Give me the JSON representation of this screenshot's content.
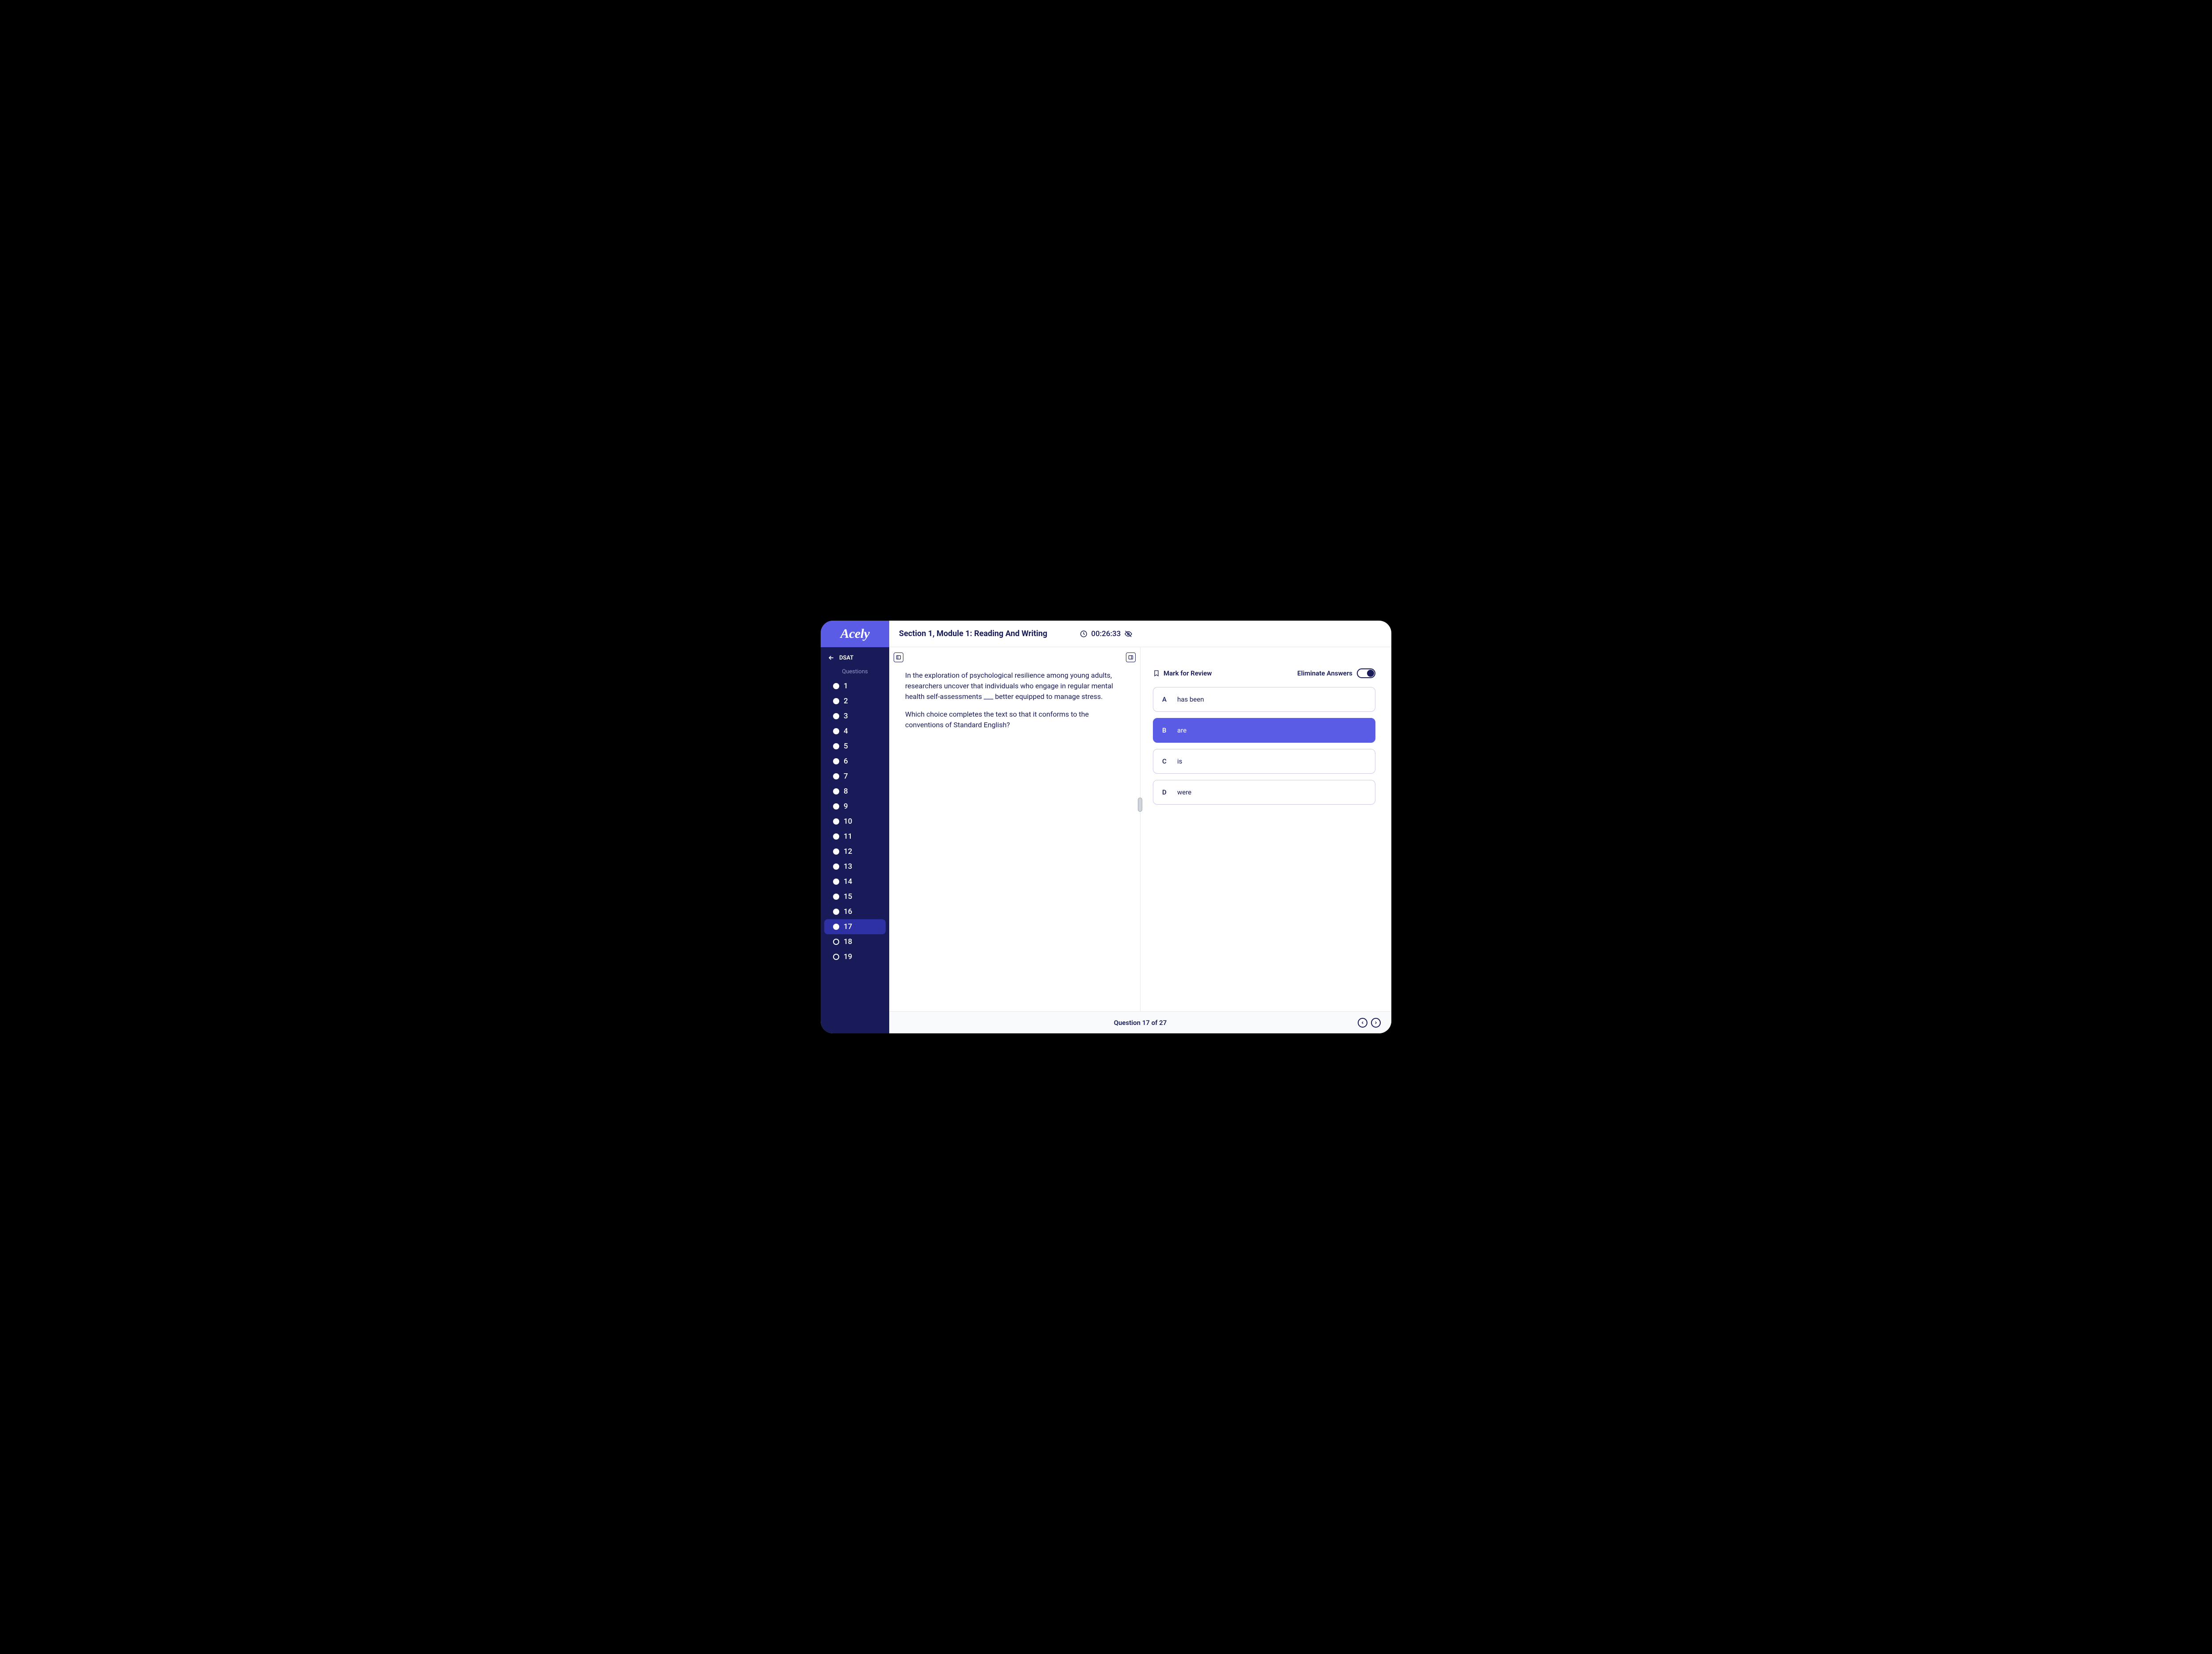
{
  "brand": {
    "name": "Acely"
  },
  "sidebar": {
    "back_label": "DSAT",
    "questions_label": "Questions",
    "current": 17,
    "total_visible": 19,
    "visited_through": 17,
    "items": [
      {
        "n": "1"
      },
      {
        "n": "2"
      },
      {
        "n": "3"
      },
      {
        "n": "4"
      },
      {
        "n": "5"
      },
      {
        "n": "6"
      },
      {
        "n": "7"
      },
      {
        "n": "8"
      },
      {
        "n": "9"
      },
      {
        "n": "10"
      },
      {
        "n": "11"
      },
      {
        "n": "12"
      },
      {
        "n": "13"
      },
      {
        "n": "14"
      },
      {
        "n": "15"
      },
      {
        "n": "16"
      },
      {
        "n": "17"
      },
      {
        "n": "18"
      },
      {
        "n": "19"
      }
    ]
  },
  "header": {
    "title": "Section 1, Module 1: Reading And Writing",
    "timer": "00:26:33"
  },
  "passage": {
    "p1": "In the exploration of psychological resilience among young adults, researchers uncover that individuals who engage in regular mental health self-assessments ___ better equipped to manage stress.",
    "p2": "Which choice completes the text so that it conforms to the conventions of Standard English?"
  },
  "review": {
    "mark_label": "Mark for Review",
    "eliminate_label": "Eliminate Answers",
    "eliminate_on": true
  },
  "choices": [
    {
      "letter": "A",
      "text": "has been",
      "selected": false
    },
    {
      "letter": "B",
      "text": "are",
      "selected": true
    },
    {
      "letter": "C",
      "text": "is",
      "selected": false
    },
    {
      "letter": "D",
      "text": "were",
      "selected": false
    }
  ],
  "footer": {
    "progress": "Question 17 of 27"
  }
}
